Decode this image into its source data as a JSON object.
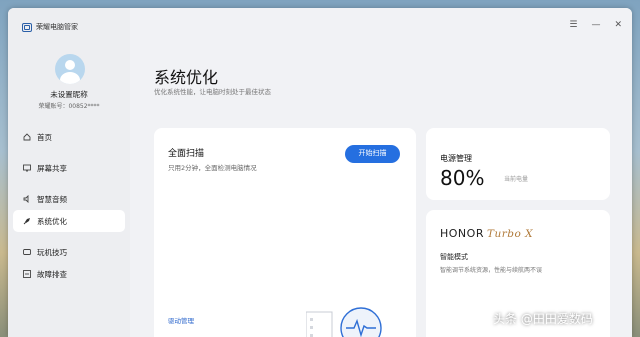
{
  "app": {
    "title": "荣耀电脑管家"
  },
  "window_controls": {
    "menu": "☰",
    "minimize": "—",
    "close": "✕"
  },
  "profile": {
    "nickname": "未设置昵称",
    "account": "荣耀账号：00852****"
  },
  "nav": [
    {
      "label": "首页",
      "icon": "home-icon"
    },
    {
      "label": "屏幕共享",
      "icon": "screen-share-icon"
    },
    {
      "label": "智慧音频",
      "icon": "audio-icon"
    },
    {
      "label": "系统优化",
      "icon": "rocket-icon",
      "active": true
    },
    {
      "label": "玩机技巧",
      "icon": "tips-icon"
    },
    {
      "label": "故障排查",
      "icon": "troubleshoot-icon"
    }
  ],
  "page": {
    "title": "系统优化",
    "subtitle": "优化系统性能，让电脑时刻处于最佳状态"
  },
  "scan": {
    "title": "全面扫描",
    "subtitle": "只用2分钟，全面检测电脑情况",
    "button": "开始扫描",
    "driver_link": "驱动管理"
  },
  "power": {
    "title": "电源管理",
    "value": "80%",
    "caption": "当前电量"
  },
  "device": {
    "brand": "HONOR",
    "model": "Turbo X",
    "mode_title": "智能模式",
    "mode_desc": "智能调节系统资源，性能与续航两不误"
  },
  "colors": {
    "accent": "#256fe0",
    "brand_gold": "#b07a3a"
  },
  "watermark": "头条 @田田爱数码"
}
